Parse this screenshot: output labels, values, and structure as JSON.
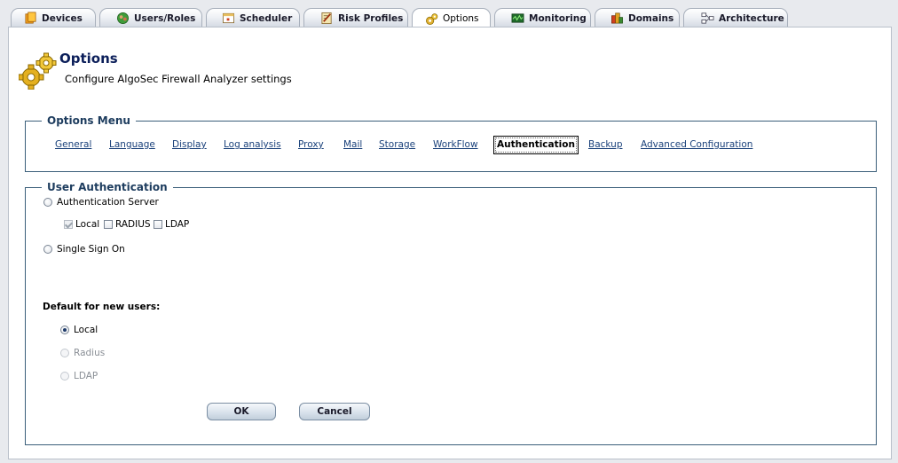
{
  "tabs": [
    {
      "label": "Devices",
      "icon": "devices-icon",
      "active": false
    },
    {
      "label": "Users/Roles",
      "icon": "users-roles-icon",
      "active": false
    },
    {
      "label": "Scheduler",
      "icon": "scheduler-icon",
      "active": false
    },
    {
      "label": "Risk Profiles",
      "icon": "risk-profiles-icon",
      "active": false
    },
    {
      "label": "Options",
      "icon": "options-gear-icon",
      "active": true
    },
    {
      "label": "Monitoring",
      "icon": "monitoring-icon",
      "active": false
    },
    {
      "label": "Domains",
      "icon": "domains-icon",
      "active": false
    },
    {
      "label": "Architecture",
      "icon": "architecture-icon",
      "active": false
    }
  ],
  "header": {
    "title": "Options",
    "subtitle": "Configure AlgoSec Firewall Analyzer settings",
    "icon": "gears-icon"
  },
  "options_menu": {
    "legend": "Options Menu",
    "active": "Authentication",
    "items": [
      "General",
      "Language",
      "Display",
      "Log analysis",
      "Proxy",
      "Mail",
      "Storage",
      "WorkFlow",
      "Authentication",
      "Backup",
      "Advanced Configuration"
    ]
  },
  "user_auth": {
    "legend": "User Authentication",
    "auth_server_label": "Authentication Server",
    "auth_server_selected": false,
    "methods": [
      {
        "label": "Local",
        "checked": true,
        "disabled": true
      },
      {
        "label": "RADIUS",
        "checked": false,
        "disabled": false
      },
      {
        "label": "LDAP",
        "checked": false,
        "disabled": false
      }
    ],
    "sso_label": "Single Sign On",
    "sso_selected": false,
    "default_label": "Default for new users:",
    "defaults": [
      {
        "label": "Local",
        "selected": true,
        "disabled": false
      },
      {
        "label": "Radius",
        "selected": false,
        "disabled": true
      },
      {
        "label": "LDAP",
        "selected": false,
        "disabled": true
      }
    ]
  },
  "buttons": {
    "ok": "OK",
    "cancel": "Cancel"
  },
  "colors": {
    "title": "#0c1f5a",
    "link": "#19407a",
    "legend": "#1d3c5e",
    "fieldset_border": "#3b5f7a"
  }
}
